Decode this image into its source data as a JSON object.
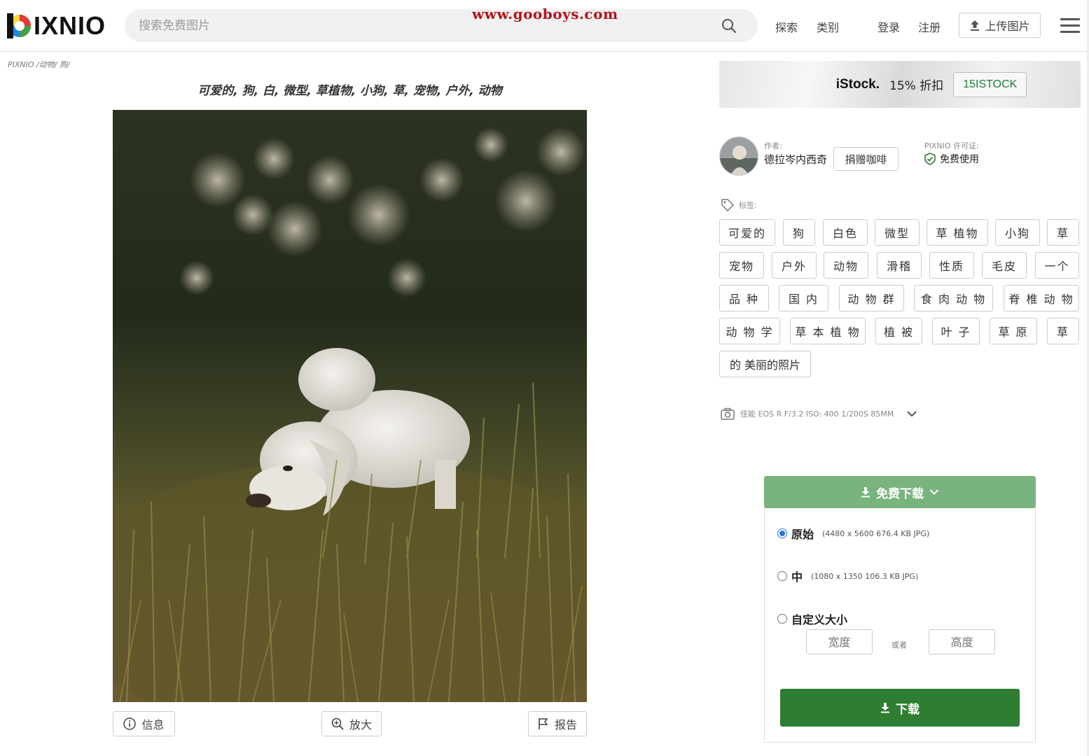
{
  "header": {
    "logo_text": "IXNIO",
    "search_placeholder": "搜索免费图片",
    "watermark": "www.gooboys.com",
    "nav": {
      "explore": "探索",
      "categories": "类别",
      "login": "登录",
      "register": "注册"
    },
    "upload_label": "上传图片"
  },
  "breadcrumb": "PIXNIO /动物/ 狗/",
  "title": "可爱的, 狗, 白, 微型, 草植物, 小狗, 草, 宠物, 户外, 动物",
  "actions": {
    "info": "信息",
    "zoom": "放大",
    "report": "报告"
  },
  "ad": {
    "brand": "iStock.",
    "offer": "15% 折扣",
    "code": "15ISTOCK"
  },
  "author": {
    "label": "作者:",
    "name": "德拉岑内西奇",
    "donate": "捐赠咖啡"
  },
  "license": {
    "label": "PIXNIO 许可证:",
    "value": "免费使用"
  },
  "tags_label": "标签:",
  "tags": [
    "可爱的",
    "狗",
    "白色",
    "微型",
    "草 植物",
    "小狗",
    "草",
    "宠物",
    "户外",
    "动物",
    "滑稽",
    "性质",
    "毛皮",
    "一个",
    "品 种",
    "国 内",
    "动 物 群",
    "食 肉 动 物",
    "脊 椎 动 物",
    "动 物 学",
    "草 本 植 物",
    "植 被",
    "叶 子",
    "草 原",
    "草",
    "的 美丽的照片"
  ],
  "camera": "佳能 EOS R F/3.2 ISO: 400 1/200S 85MM",
  "download": {
    "header": "免费下载",
    "options": [
      {
        "label": "原始",
        "meta": "(4480 x 5600 676.4 KB JPG)",
        "selected": true
      },
      {
        "label": "中",
        "meta": "(1080 x 1350 106.3 KB JPG)",
        "selected": false
      },
      {
        "label": "自定义大小",
        "meta": "",
        "selected": false
      }
    ],
    "width_placeholder": "宽度",
    "or": "或者",
    "height_placeholder": "高度",
    "button": "下载"
  },
  "colors": {
    "accent_green": "#2e7d32",
    "light_green": "#79b37e",
    "watermark_red": "#b3141a",
    "radio_blue": "#2b73d9"
  }
}
